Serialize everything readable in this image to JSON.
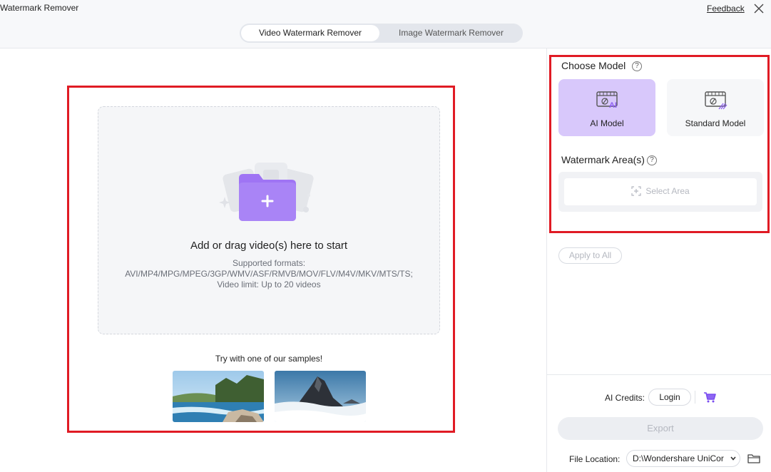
{
  "titlebar": {
    "app_title": "Watermark Remover",
    "feedback_label": "Feedback",
    "close_icon": "close-icon"
  },
  "tabs": [
    {
      "label": "Video Watermark Remover",
      "active": true
    },
    {
      "label": "Image Watermark Remover",
      "active": false
    }
  ],
  "dropzone": {
    "title": "Add or drag video(s) here to start",
    "formats_label": "Supported formats:",
    "formats": "AVI/MP4/MPG/MPEG/3GP/WMV/ASF/RMVB/MOV/FLV/M4V/MKV/MTS/TS;",
    "limit": "Video limit: Up to 20 videos",
    "icon": "folder-add-icon"
  },
  "samples": {
    "title": "Try with one of our samples!",
    "items": [
      {
        "name": "river-sample"
      },
      {
        "name": "mountain-sample"
      }
    ]
  },
  "sidebar": {
    "choose_model_label": "Choose Model",
    "models": [
      {
        "label": "AI Model",
        "selected": true
      },
      {
        "label": "Standard Model",
        "selected": false
      }
    ],
    "watermark_area_label": "Watermark Area(s)",
    "select_area_label": "Select Area",
    "apply_all_label": "Apply to All",
    "credits_label": "AI Credits:",
    "login_label": "Login",
    "export_label": "Export",
    "file_location_label": "File Location:",
    "file_location_value": "D:\\Wondershare UniCor"
  },
  "colors": {
    "accent_purple": "#a27bf5",
    "ai_model_bg": "#d8c8fb",
    "highlight_red": "#e01b24"
  }
}
